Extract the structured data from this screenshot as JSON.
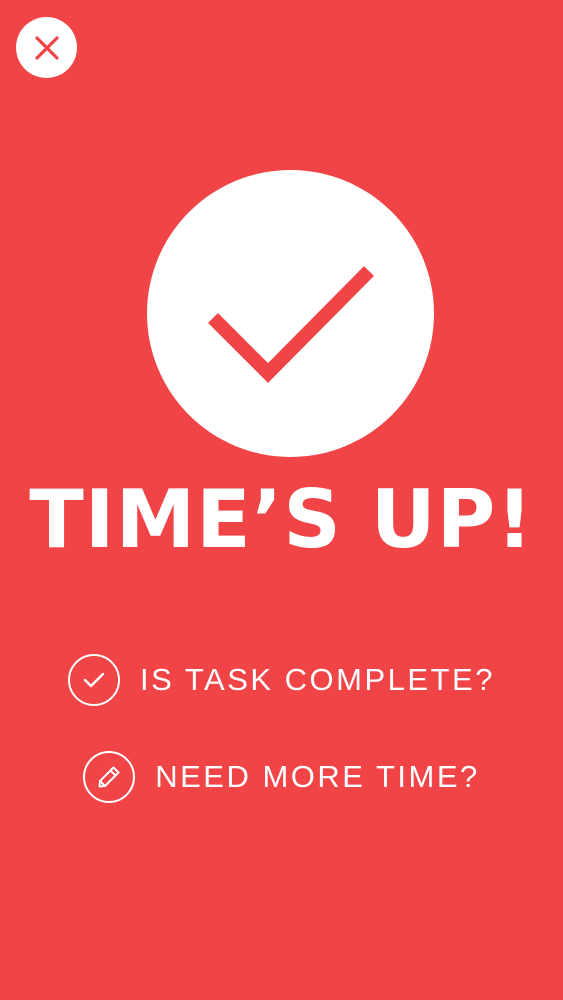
{
  "colors": {
    "background": "#f04447",
    "foreground": "#ffffff",
    "accent": "#f04447"
  },
  "close_button": {
    "icon": "close-icon"
  },
  "hero": {
    "icon": "checkmark-icon",
    "headline": "TIME’S UP!"
  },
  "options": {
    "complete": {
      "icon": "check-circle-icon",
      "label": "IS TASK COMPLETE?"
    },
    "more_time": {
      "icon": "pencil-circle-icon",
      "label": "NEED MORE TIME?"
    }
  }
}
